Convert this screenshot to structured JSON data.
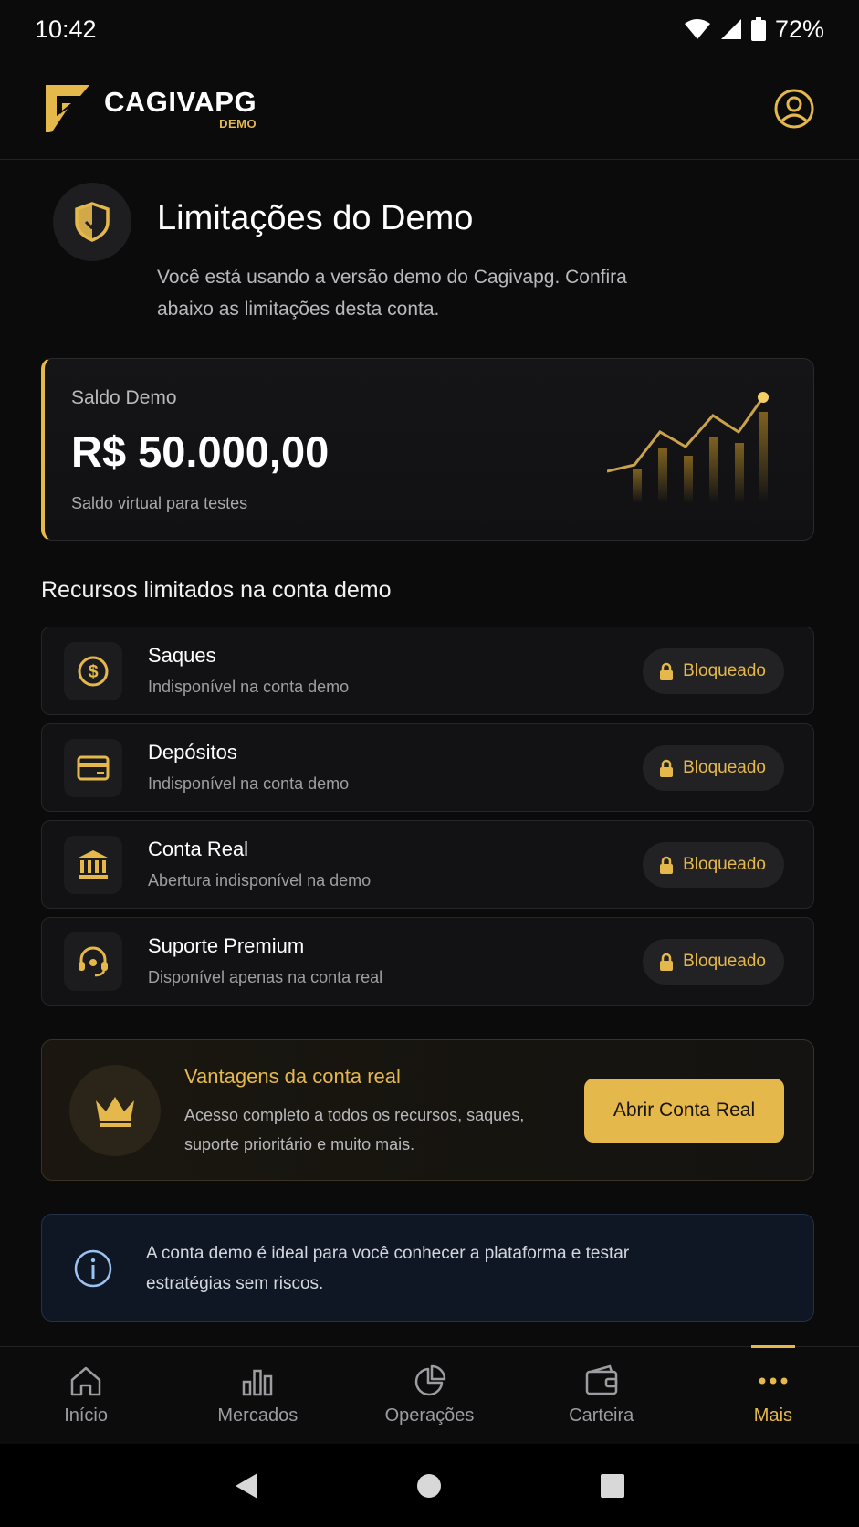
{
  "status": {
    "time": "10:42",
    "battery": "72%"
  },
  "header": {
    "brand": "CAGIVAPG",
    "badge": "DEMO",
    "profile_icon": "user-circle-icon"
  },
  "intro": {
    "title": "Limitações do Demo",
    "subtitle": "Você está usando a versão demo do Cagivapg. Confira abaixo as limitações desta conta."
  },
  "balance": {
    "label": "Saldo Demo",
    "value": "R$ 50.000,00",
    "note": "Saldo virtual para testes"
  },
  "section_title": "Recursos limitados na conta demo",
  "features": [
    {
      "icon": "dollar-coin-icon",
      "title": "Saques",
      "desc": "Indisponível na conta demo",
      "status": "Bloqueado"
    },
    {
      "icon": "credit-card-icon",
      "title": "Depósitos",
      "desc": "Indisponível na conta demo",
      "status": "Bloqueado"
    },
    {
      "icon": "bank-icon",
      "title": "Conta Real",
      "desc": "Abertura indisponível na demo",
      "status": "Bloqueado"
    },
    {
      "icon": "headset-icon",
      "title": "Suporte Premium",
      "desc": "Disponível apenas na conta real",
      "status": "Bloqueado"
    }
  ],
  "promo": {
    "title": "Vantagens da conta real",
    "desc": "Acesso completo a todos os recursos, saques, suporte prioritário e muito mais.",
    "button": "Abrir Conta Real"
  },
  "info": {
    "text": "A conta demo é ideal para você conhecer a plataforma e testar estratégias sem riscos."
  },
  "nav": [
    {
      "label": "Início",
      "icon": "home-icon"
    },
    {
      "label": "Mercados",
      "icon": "bar-chart-icon"
    },
    {
      "label": "Operações",
      "icon": "pie-chart-icon"
    },
    {
      "label": "Carteira",
      "icon": "wallet-icon"
    },
    {
      "label": "Mais",
      "icon": "more-dots-icon",
      "active": true
    }
  ],
  "colors": {
    "accent": "#e5b84c",
    "background": "#0b0b0c",
    "info": "#9cc2f0"
  }
}
